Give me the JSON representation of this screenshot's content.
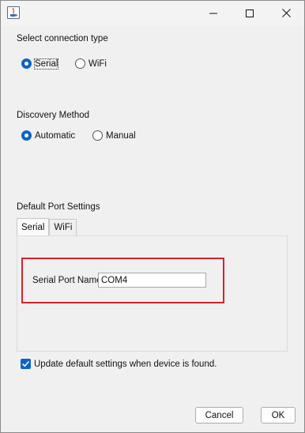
{
  "window": {
    "title": "",
    "app_icon": "java-icon",
    "controls": [
      "minimize-icon",
      "maximize-icon",
      "close-icon"
    ]
  },
  "connection_type": {
    "label": "Select connection type",
    "options": [
      {
        "label": "Serial",
        "selected": true
      },
      {
        "label": "WiFi",
        "selected": false
      }
    ]
  },
  "discovery_method": {
    "label": "Discovery Method",
    "options": [
      {
        "label": "Automatic",
        "selected": true
      },
      {
        "label": "Manual",
        "selected": false
      }
    ]
  },
  "default_port_settings": {
    "label": "Default Port Settings",
    "tabs": [
      {
        "label": "Serial",
        "active": true
      },
      {
        "label": "WiFi",
        "active": false
      }
    ],
    "serial_port_name_label": "Serial Port Name",
    "serial_port_name_value": "COM4",
    "highlight_color": "#d9232a"
  },
  "update_defaults": {
    "label": "Update default settings when device is found.",
    "checked": true
  },
  "buttons": {
    "cancel": "Cancel",
    "ok": "OK"
  },
  "colors": {
    "accent": "#0a64c8",
    "background": "#f0f0f0"
  }
}
